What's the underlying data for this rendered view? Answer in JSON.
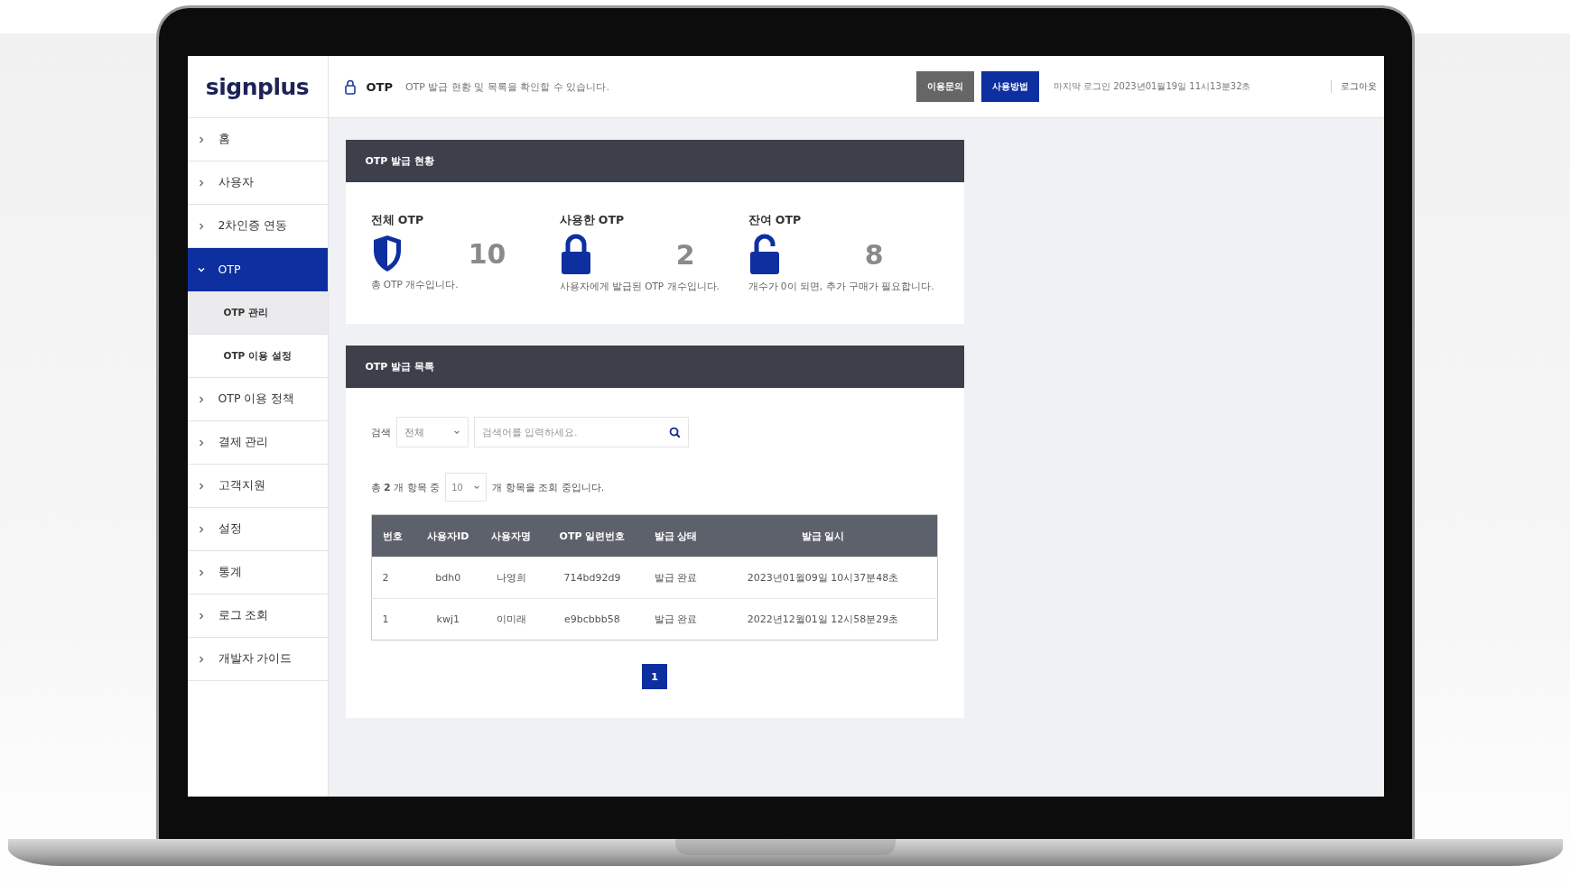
{
  "logo": "signplus",
  "header": {
    "title": "OTP",
    "description": "OTP 발급 현황 및 목록을 확인할 수 있습니다.",
    "buttons": [
      {
        "label": "이용문의",
        "kind": "secondary"
      },
      {
        "label": "사용방법",
        "kind": "primary"
      }
    ],
    "last_login": "마지막 로그인 2023년01월19일 11시13분32초",
    "logout": "로그아웃"
  },
  "sidebar": {
    "items": [
      {
        "label": "홈",
        "expanded": false,
        "selected": false
      },
      {
        "label": "사용자",
        "expanded": false,
        "selected": false
      },
      {
        "label": "2차인증 연동",
        "expanded": false,
        "selected": false
      },
      {
        "label": "OTP",
        "expanded": true,
        "selected": true,
        "children": [
          {
            "label": "OTP 관리",
            "selected": true
          },
          {
            "label": "OTP 이용 설정",
            "selected": false
          }
        ]
      },
      {
        "label": "OTP 이용 정책",
        "expanded": false,
        "selected": false
      },
      {
        "label": "결제 관리",
        "expanded": false,
        "selected": false
      },
      {
        "label": "고객지원",
        "expanded": false,
        "selected": false
      },
      {
        "label": "설정",
        "expanded": false,
        "selected": false
      },
      {
        "label": "통계",
        "expanded": false,
        "selected": false
      },
      {
        "label": "로그 조회",
        "expanded": false,
        "selected": false
      },
      {
        "label": "개발자 가이드",
        "expanded": false,
        "selected": false
      }
    ]
  },
  "status_panel": {
    "title": "OTP 발급 현황",
    "stats": [
      {
        "label": "전체 OTP",
        "kind": "shield",
        "value": "10",
        "note": "총 OTP 개수입니다."
      },
      {
        "label": "사용한 OTP",
        "kind": "locked",
        "value": "2",
        "note": "사용자에게 발급된 OTP 개수입니다."
      },
      {
        "label": "잔여 OTP",
        "kind": "unlocked",
        "value": "8",
        "note": "개수가 0이 되면, 추가 구매가 필요합니다."
      }
    ]
  },
  "list_panel": {
    "title": "OTP 발급 목록",
    "search": {
      "label": "검색",
      "filter": "전체",
      "placeholder": "검색어를 입력하세요."
    },
    "summary": {
      "total": "총 **2** 개 항목 중",
      "page_size": "10",
      "suffix": "개 항목을 조회 중입니다."
    },
    "table": {
      "columns": [
        "번호",
        "사용자ID",
        "사용자명",
        "OTP 일련번호",
        "발급 상태",
        "발급 일시"
      ],
      "rows": [
        [
          "2",
          "bdh0",
          "나영희",
          "714bd92d9",
          "발급 완료",
          "2023년01월09일 10시37분48초"
        ],
        [
          "1",
          "kwj1",
          "이미래",
          "e9bcbbb58",
          "발급 완료",
          "2022년12월01일 12시58분29초"
        ]
      ]
    },
    "pagination": [
      {
        "label": "1",
        "selected": true
      }
    ]
  }
}
